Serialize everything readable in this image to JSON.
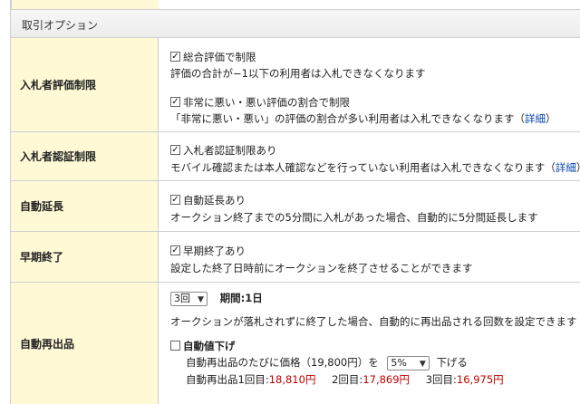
{
  "section": {
    "title": "取引オプション"
  },
  "rows": {
    "hyouka": {
      "label": "入札者評価制限",
      "opt1_label": "総合評価で制限",
      "opt1_desc": "評価の合計が−1以下の利用者は入札できなくなります",
      "opt2_label": "非常に悪い・悪い評価の割合で制限",
      "opt2_desc_pre": "「非常に悪い・悪い」の評価の割合が多い利用者は入札できなくなります（",
      "opt2_link": "詳細",
      "opt2_desc_post": "）"
    },
    "ninsho": {
      "label": "入札者認証制限",
      "opt_label": "入札者認証制限あり",
      "desc_pre": "モバイル確認または本人確認などを行っていない利用者は入札できなくなります（",
      "link": "詳細",
      "desc_post": "）"
    },
    "encho": {
      "label": "自動延長",
      "opt_label": "自動延長あり",
      "desc": "オークション終了までの5分間に入札があった場合、自動的に5分間延長します"
    },
    "souki": {
      "label": "早期終了",
      "opt_label": "早期終了あり",
      "desc": "設定した終了日時前にオークションを終了させることができます"
    },
    "saishuppin": {
      "label": "自動再出品",
      "count_value": "3回",
      "period_label": "期間:",
      "period_value": "1日",
      "desc": "オークションが落札されずに終了した場合、自動的に再出品される回数を設定できます",
      "discount_label": "自動値下げ",
      "price_pre": "自動再出品のたびに価格（",
      "price_value": "19,800円",
      "price_post": "）を",
      "discount_value": "5%",
      "price_suffix": "下げる",
      "r1_label": "自動再出品1回目:",
      "r1_value": "18,810円",
      "r2_label": "2回目:",
      "r2_value": "17,869円",
      "r3_label": "3回目:",
      "r3_value": "16,975円"
    }
  }
}
